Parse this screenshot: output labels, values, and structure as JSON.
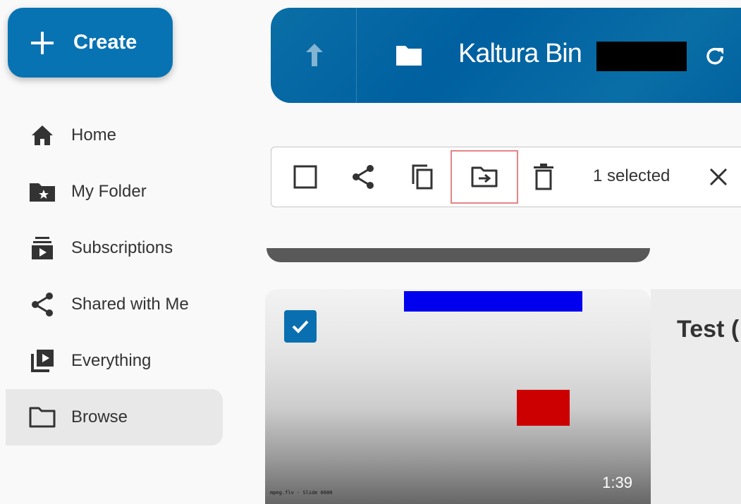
{
  "create": {
    "label": "Create"
  },
  "nav": {
    "items": [
      {
        "label": "Home",
        "icon": "home-icon"
      },
      {
        "label": "My Folder",
        "icon": "folder-star-icon"
      },
      {
        "label": "Subscriptions",
        "icon": "subscriptions-icon"
      },
      {
        "label": "Shared with Me",
        "icon": "share-icon"
      },
      {
        "label": "Everything",
        "icon": "video-library-icon"
      },
      {
        "label": "Browse",
        "icon": "folder-outline-icon",
        "active": true
      }
    ]
  },
  "header": {
    "breadcrumb": "Kaltura Bin"
  },
  "toolbar": {
    "selected_text": "1 selected"
  },
  "media": {
    "duration": "1:39",
    "title": "Test (",
    "thumb_caption": "mpeg.flv - Slide 0000"
  },
  "colors": {
    "brand": "#0873b3",
    "highlight_border": "#e38585"
  }
}
